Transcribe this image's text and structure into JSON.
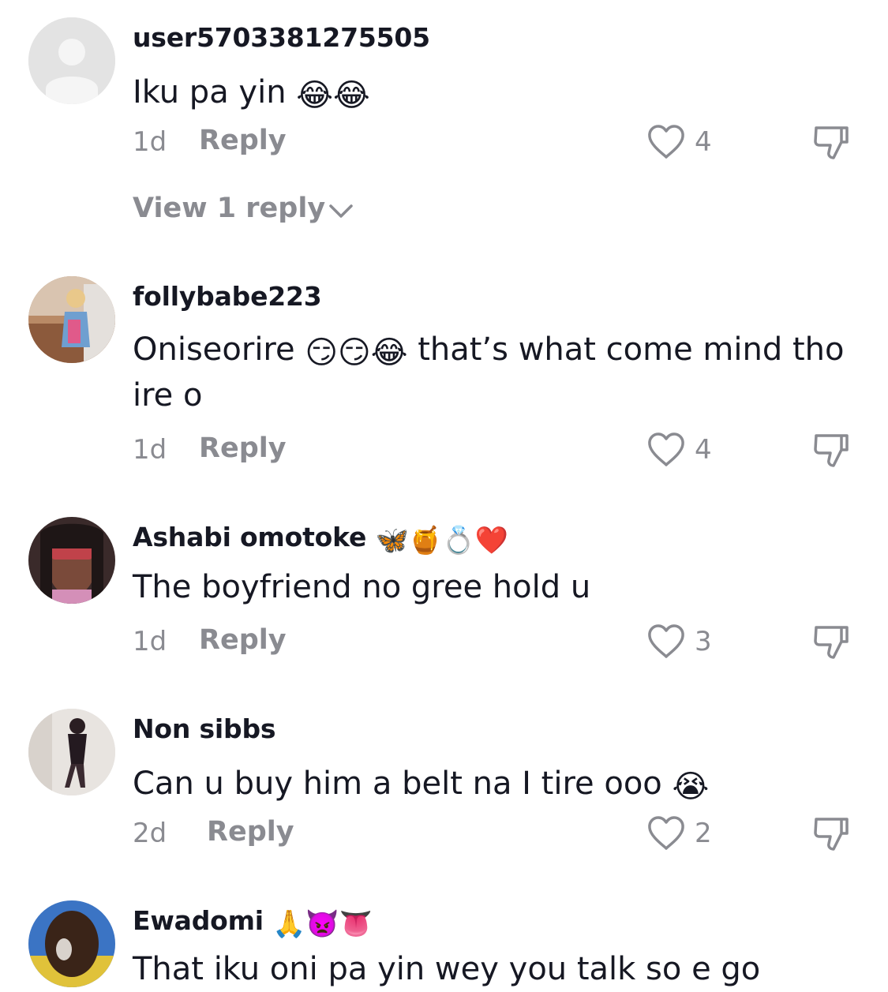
{
  "comments": [
    {
      "username": "user5703381275505",
      "username_emoji": "",
      "text": "Iku pa yin",
      "text_emoji": "😂😂",
      "text_after": "",
      "time": "1d",
      "reply_label": "Reply",
      "likes": "4",
      "avatar": "default-avatar",
      "view_replies": "View 1 reply"
    },
    {
      "username": "follybabe223",
      "username_emoji": "",
      "text": "Oniseorire",
      "text_emoji": "😏😏😂",
      "text_after": "that’s what come mind tho ire o",
      "time": "1d",
      "reply_label": "Reply",
      "likes": "4",
      "avatar": "photo-avatar"
    },
    {
      "username": "Ashabi omotoke",
      "username_emoji": "🦋🍯💍❤️",
      "text": "The boyfriend no gree hold u",
      "text_emoji": "",
      "text_after": "",
      "time": "1d",
      "reply_label": "Reply",
      "likes": "3",
      "avatar": "photo-avatar"
    },
    {
      "username": "Non sibbs",
      "username_emoji": "",
      "text": "Can u buy him a belt na I tire ooo",
      "text_emoji": "😭",
      "text_after": "",
      "time": "2d",
      "reply_label": "Reply",
      "likes": "2",
      "avatar": "photo-avatar"
    },
    {
      "username": "Ewadomi",
      "username_emoji": "🙏👿👅",
      "text": "That iku oni pa yin wey you talk so e go",
      "text_emoji": "",
      "text_after": "",
      "avatar": "photo-avatar"
    }
  ],
  "colors": {
    "text": "#161823",
    "secondary": "#8a8b91",
    "background": "#ffffff"
  },
  "icons": [
    "heart-outline-icon",
    "thumbs-down-icon",
    "chevron-down-icon",
    "default-avatar-icon"
  ]
}
